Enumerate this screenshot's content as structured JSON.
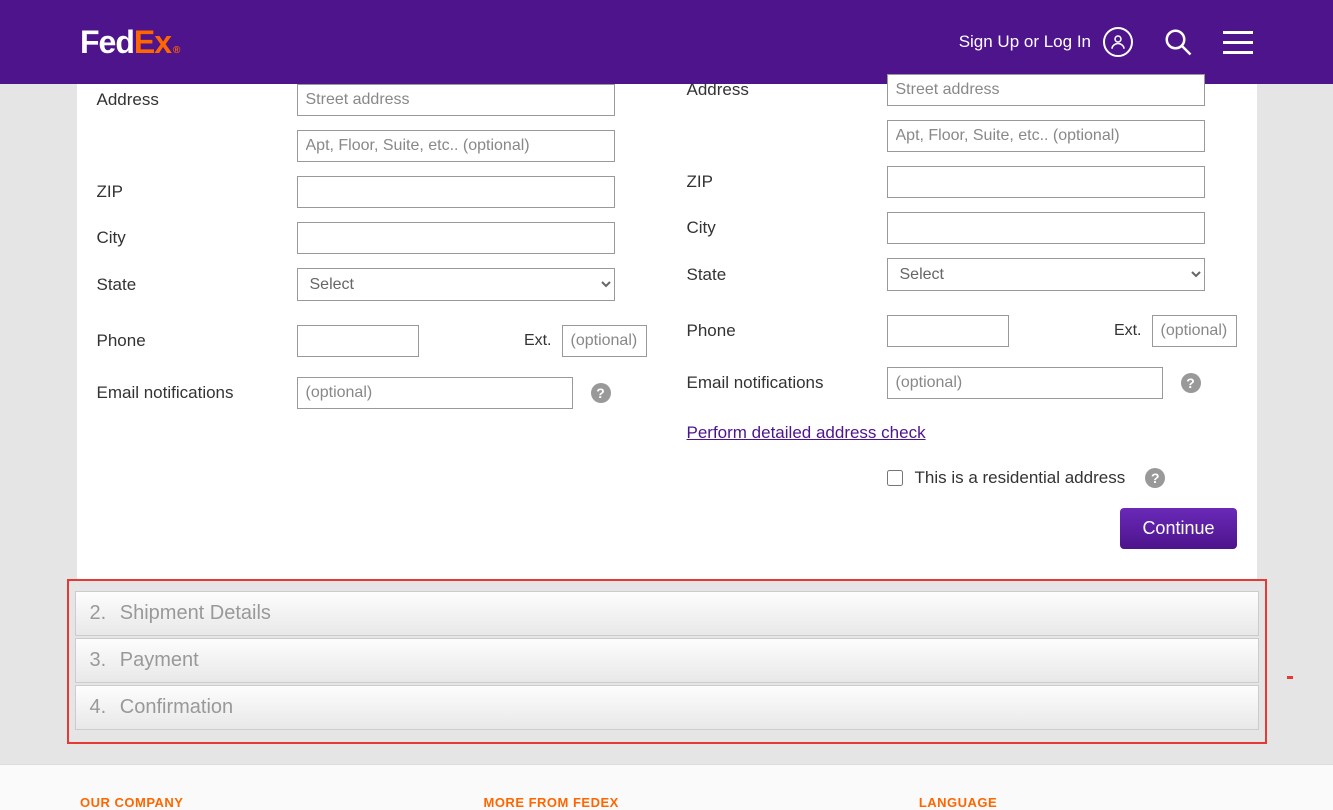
{
  "header": {
    "logo_fed": "Fed",
    "logo_ex": "Ex",
    "logo_reg": "®",
    "signin_label": "Sign Up or Log In"
  },
  "from": {
    "address_label": "Address",
    "address_placeholder": "Street address",
    "address2_placeholder": "Apt, Floor, Suite, etc.. (optional)",
    "zip_label": "ZIP",
    "city_label": "City",
    "state_label": "State",
    "state_select": "Select",
    "phone_label": "Phone",
    "ext_label": "Ext.",
    "ext_placeholder": "(optional)",
    "email_label": "Email notifications",
    "email_placeholder": "(optional)"
  },
  "to": {
    "address_label": "Address",
    "address_placeholder": "Street address",
    "address2_placeholder": "Apt, Floor, Suite, etc.. (optional)",
    "zip_label": "ZIP",
    "city_label": "City",
    "state_label": "State",
    "state_select": "Select",
    "phone_label": "Phone",
    "ext_label": "Ext.",
    "ext_placeholder": "(optional)",
    "email_label": "Email notifications",
    "email_placeholder": "(optional)",
    "address_check_link": "Perform detailed address check",
    "residential_label": "This is a residential address"
  },
  "continue_label": "Continue",
  "accordion": [
    {
      "num": "2.",
      "label": "Shipment Details"
    },
    {
      "num": "3.",
      "label": "Payment"
    },
    {
      "num": "4.",
      "label": "Confirmation"
    }
  ],
  "footer": {
    "col1": "OUR COMPANY",
    "col2": "MORE FROM FEDEX",
    "col3": "LANGUAGE"
  },
  "help_char": "?"
}
